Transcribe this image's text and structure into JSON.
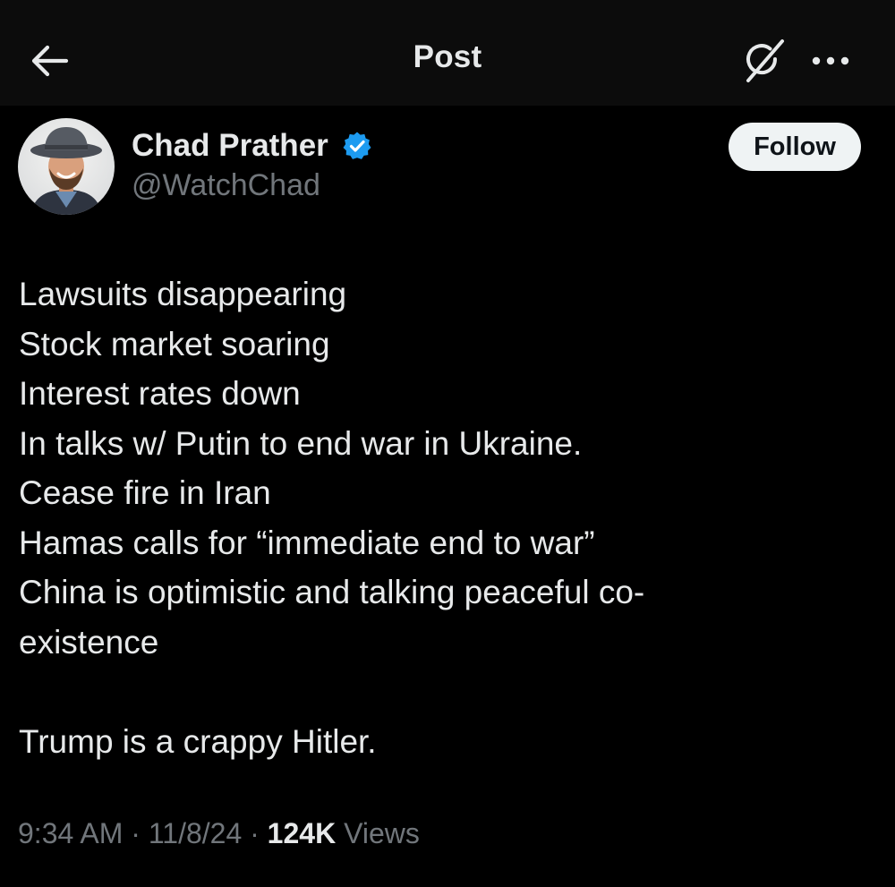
{
  "header": {
    "title": "Post",
    "back_icon": "arrow-left-icon",
    "grok_icon": "grok-icon",
    "more_icon": "more-horizontal-icon"
  },
  "author": {
    "display_name": "Chad Prather",
    "handle": "@WatchChad",
    "verified": true,
    "verified_color": "#1d9bf0",
    "follow_label": "Follow"
  },
  "tweet": {
    "lines": [
      "Lawsuits disappearing",
      "Stock market soaring",
      "Interest rates down",
      "In talks w/ Putin to end war in Ukraine.",
      "Cease fire in Iran",
      "Hamas calls for “immediate end to war”",
      "China is optimistic and talking peaceful co-",
      "existence",
      "",
      "Trump is a crappy Hitler."
    ]
  },
  "meta": {
    "time": "9:34 AM",
    "separator": "·",
    "date": "11/8/24",
    "views_count": "124K",
    "views_label": "Views"
  },
  "colors": {
    "background": "#000000",
    "header_background": "#0c0c0c",
    "text_primary": "#e7e9ea",
    "text_secondary": "#71767b",
    "follow_bg": "#eff3f4"
  }
}
